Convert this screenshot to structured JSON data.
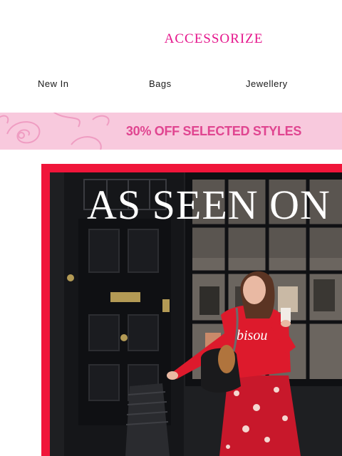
{
  "brand": {
    "logo_text": "ACCESSORIZE",
    "color": "#e5168c"
  },
  "nav": {
    "items": [
      "New In",
      "Bags",
      "Jewellery"
    ]
  },
  "promo": {
    "text": "30% OFF SELECTED STYLES",
    "background": "#f8c9dd",
    "text_color": "#e04590"
  },
  "hero": {
    "headline": "AS SEEN ON",
    "frame_color": "#f0153a",
    "sweater_text": "bisou"
  }
}
